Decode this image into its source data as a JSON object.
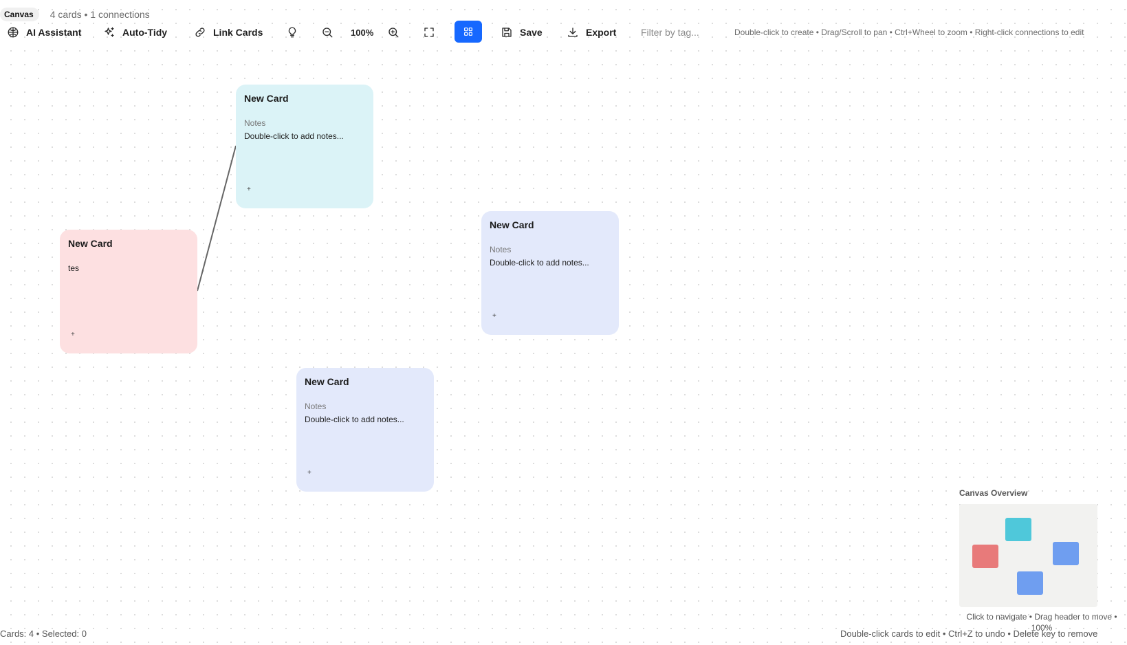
{
  "header": {
    "canvas_label": "Canvas",
    "counts": "4 cards • 1 connections"
  },
  "toolbar": {
    "ai_assistant": "AI Assistant",
    "auto_tidy": "Auto-Tidy",
    "link_cards": "Link Cards",
    "zoom": "100%",
    "save": "Save",
    "export": "Export",
    "filter_placeholder": "Filter by tag...",
    "hint": "Double-click to create • Drag/Scroll to pan • Ctrl+Wheel to zoom • Right-click connections to edit"
  },
  "cards": [
    {
      "title": "New Card",
      "notes_label": "Notes",
      "notes": "Double-click to add notes...",
      "plus": "+",
      "color": "#dbf3f7"
    },
    {
      "title": "New Card",
      "body": "tes",
      "plus": "+",
      "color": "#fde0e1"
    },
    {
      "title": "New Card",
      "notes_label": "Notes",
      "notes": "Double-click to add notes...",
      "plus": "+",
      "color": "#e3e9fb"
    },
    {
      "title": "New Card",
      "notes_label": "Notes",
      "notes": "Double-click to add notes...",
      "plus": "+",
      "color": "#e3e9fb"
    }
  ],
  "overview": {
    "title": "Canvas Overview",
    "hint": "Click to navigate • Drag header to move • 100%",
    "colors": [
      "#4fc8da",
      "#e87a7a",
      "#6f9ef0",
      "#6f9ef0"
    ]
  },
  "status": {
    "left": "Cards: 4 • Selected: 0",
    "right": "Double-click cards to edit • Ctrl+Z to undo • Delete key to remove"
  },
  "colors": {
    "accent": "#1668ff",
    "connector": "#666666"
  }
}
